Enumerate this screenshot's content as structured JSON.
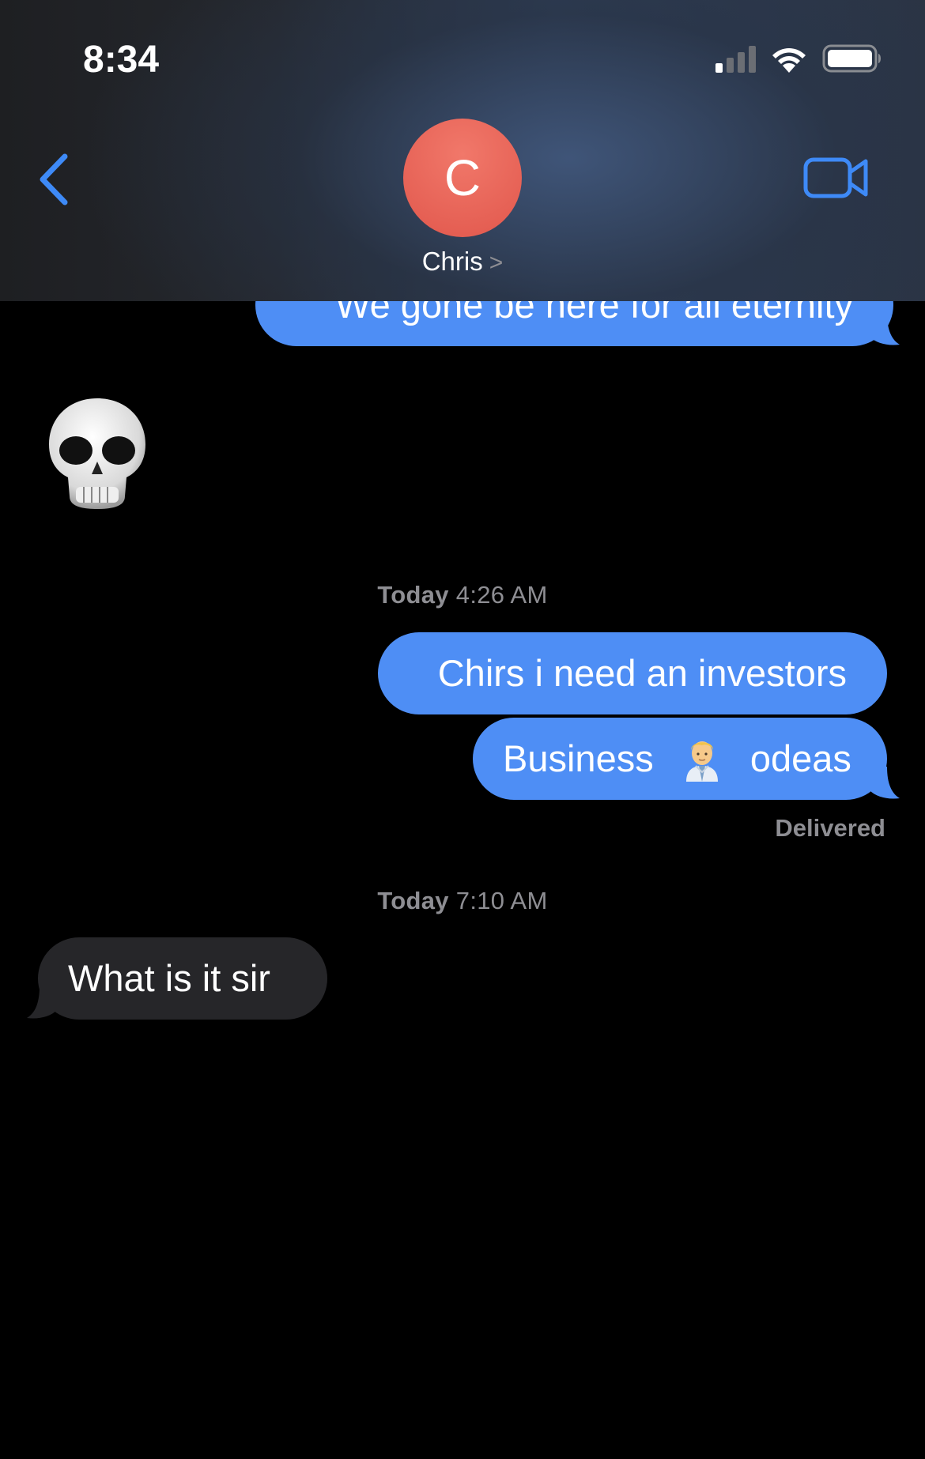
{
  "status_bar": {
    "time": "8:34",
    "icons": [
      "cellular-signal-icon",
      "wifi-icon",
      "battery-icon"
    ]
  },
  "header": {
    "back_icon": "chevron-left-icon",
    "avatar_initial": "C",
    "avatar_color": "#e8605a",
    "contact_name": "Chris",
    "contact_chevron": ">",
    "video_icon": "video-camera-icon"
  },
  "colors": {
    "accent": "#3e8af7",
    "outgoing_bubble": "#4e8ef5",
    "incoming_bubble": "#262629",
    "meta_text": "#8e8e93"
  },
  "messages": {
    "partial_top": "We gone be here for all eternity",
    "skull_emoji": "💀",
    "timestamp1_day": "Today",
    "timestamp1_time": "4:26 AM",
    "msg1": "Chirs i need an investors",
    "msg2_part1": "Business",
    "msg2_emoji_name": "man-office-worker-emoji",
    "msg2_part2": "odeas",
    "delivered": "Delivered",
    "timestamp2_day": "Today",
    "timestamp2_time": "7:10 AM",
    "reply": "What is it sir"
  }
}
